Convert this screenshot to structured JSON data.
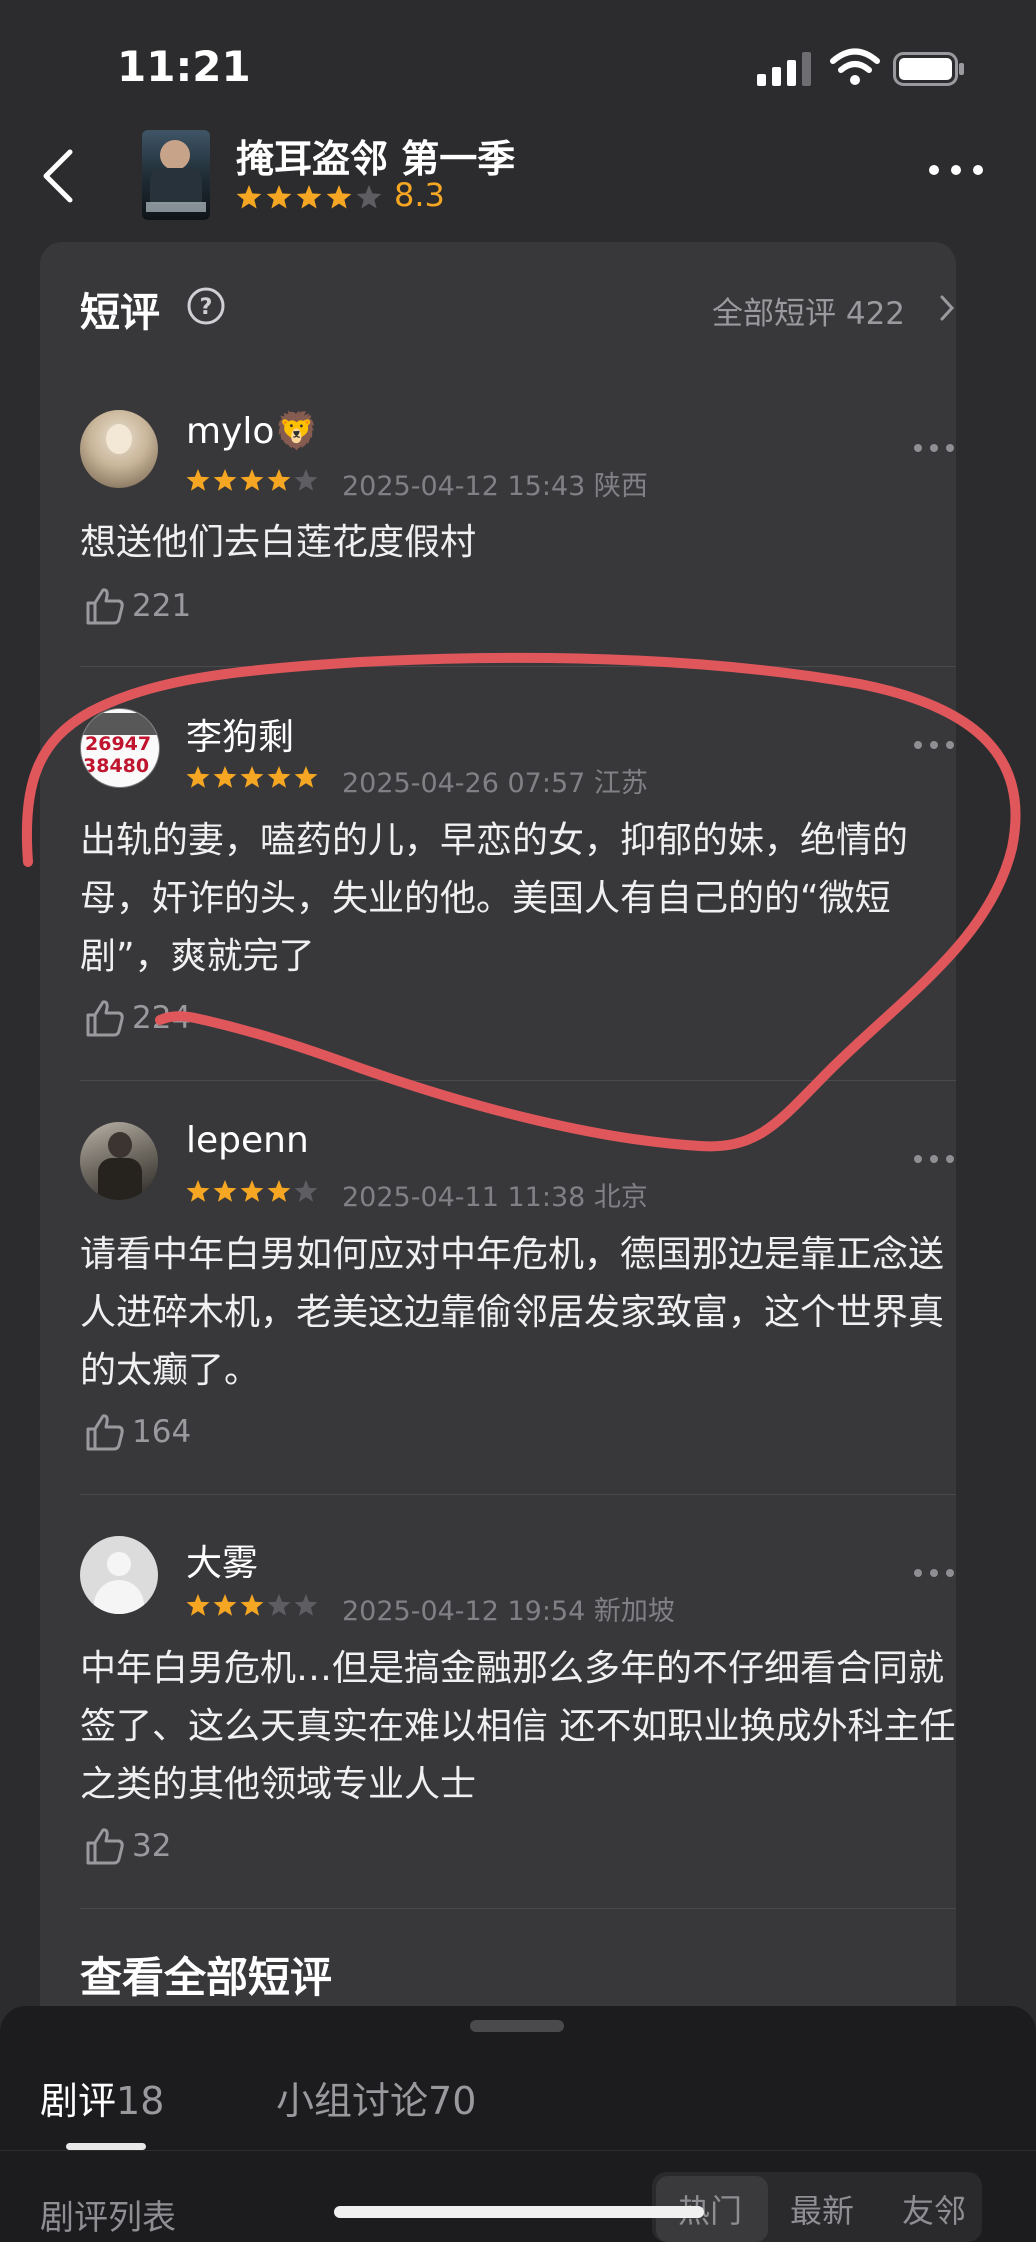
{
  "status_bar": {
    "time": "11:21"
  },
  "nav": {
    "title": "掩耳盗邻 第一季",
    "rating": "8.3",
    "stars": 4,
    "icons": {
      "back": "chevron-left-icon",
      "more": "more-horizontal-icon"
    }
  },
  "section": {
    "title": "短评",
    "all_link": "全部短评 422",
    "view_all": "查看全部短评"
  },
  "comments": [
    {
      "user": "mylo🦁",
      "stars": 4,
      "date": "2025-04-12 15:43",
      "location": "陕西",
      "text": "想送他们去白莲花度假村",
      "likes": "221"
    },
    {
      "user": "李狗剩",
      "stars": 5,
      "date": "2025-04-26 07:57",
      "location": "江苏",
      "text": "出轨的妻，嗑药的儿，早恋的女，抑郁的妹，绝情的母，奸诈的头，失业的他。美国人有自己的的“微短剧”，爽就完了",
      "likes": "224",
      "avatar_text": [
        "26947",
        "38480"
      ]
    },
    {
      "user": "lepenn",
      "stars": 4,
      "date": "2025-04-11 11:38",
      "location": "北京",
      "text": "请看中年白男如何应对中年危机，德国那边是靠正念送人进碎木机，老美这边靠偷邻居发家致富，这个世界真的太癫了。",
      "likes": "164"
    },
    {
      "user": "大雾",
      "stars": 3,
      "date": "2025-04-12 19:54",
      "location": "新加坡",
      "text": "中年白男危机…但是搞金融那么多年的不仔细看合同就签了、这么天真实在难以相信 还不如职业换成外科主任之类的其他领域专业人士",
      "likes": "32"
    }
  ],
  "bottom_sheet": {
    "tabs": [
      {
        "label": "剧评",
        "count": "18",
        "active": true
      },
      {
        "label": "小组讨论",
        "count": "70",
        "active": false
      }
    ],
    "list_label": "剧评列表",
    "sort_options": [
      "热门",
      "最新",
      "友邻"
    ],
    "sort_selected": "热门"
  },
  "colors": {
    "background": "#2c2c2e",
    "card": "#38383b",
    "star": "#f5a623",
    "annotation": "#e0575b"
  }
}
